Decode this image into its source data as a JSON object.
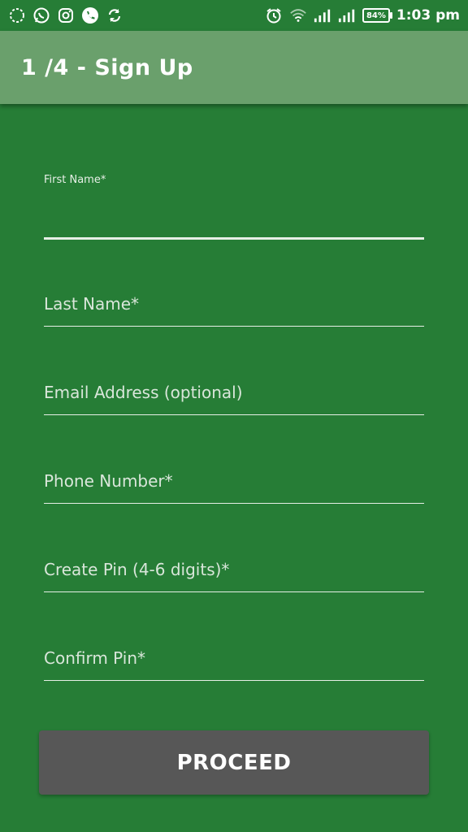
{
  "status_bar": {
    "left_icons": [
      "loading-circle-icon",
      "whatsapp-icon",
      "instagram-icon",
      "phone-icon",
      "sync-icon"
    ],
    "right_icons": [
      "alarm-icon",
      "wifi-icon",
      "signal-icon",
      "signal-icon"
    ],
    "battery": "84%",
    "time": "1:03 pm"
  },
  "app_bar": {
    "title": "1 /4 - Sign Up"
  },
  "form": {
    "first_name_label": "First Name*",
    "last_name_label": "Last Name*",
    "email_label": "Email Address (optional)",
    "phone_label": "Phone Number*",
    "pin_label": "Create Pin (4-6 digits)*",
    "confirm_pin_label": "Confirm Pin*"
  },
  "proceed_label": "PROCEED",
  "colors": {
    "background": "#267d36",
    "app_bar": "#6aa06c",
    "button": "#575757"
  }
}
